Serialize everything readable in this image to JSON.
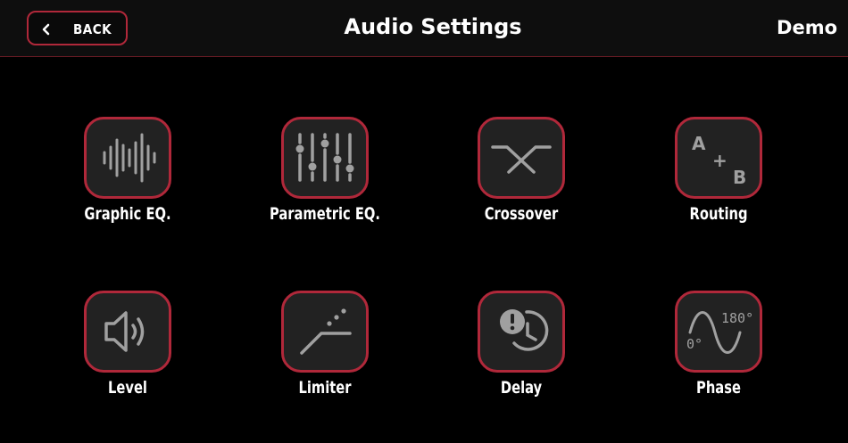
{
  "header": {
    "back_label": "BACK",
    "title": "Audio Settings",
    "mode": "Demo"
  },
  "tiles": [
    {
      "label": "Graphic EQ.",
      "icon": "graphic-eq-icon"
    },
    {
      "label": "Parametric EQ.",
      "icon": "parametric-eq-icon"
    },
    {
      "label": "Crossover",
      "icon": "crossover-icon"
    },
    {
      "label": "Routing",
      "icon": "routing-icon",
      "icon_text": [
        "A",
        "+",
        "B"
      ]
    },
    {
      "label": "Level",
      "icon": "speaker-icon"
    },
    {
      "label": "Limiter",
      "icon": "limiter-icon"
    },
    {
      "label": "Delay",
      "icon": "delay-icon"
    },
    {
      "label": "Phase",
      "icon": "phase-icon",
      "icon_text": [
        "180°",
        "0°"
      ]
    }
  ],
  "colors": {
    "accent": "#b0283a",
    "tile_fill": "#222222",
    "icon_gray": "#a0a0a0",
    "background": "#000000"
  }
}
